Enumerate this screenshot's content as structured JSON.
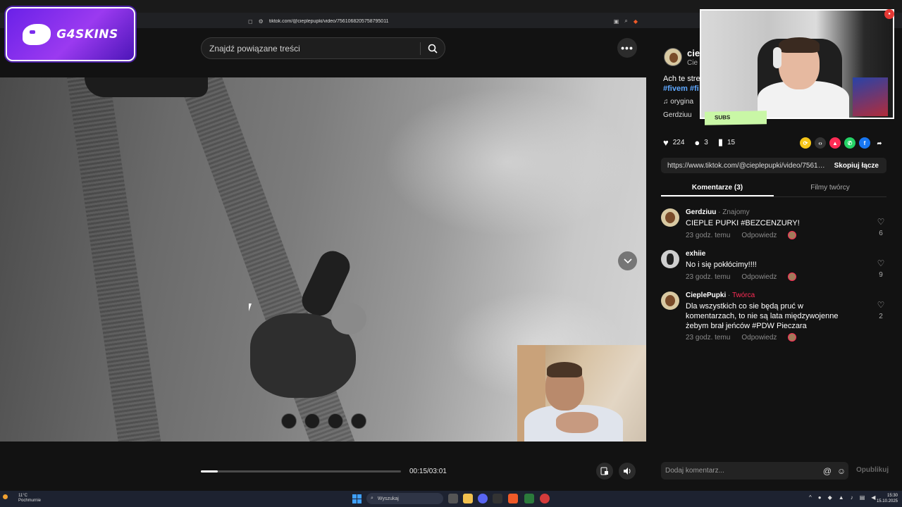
{
  "browser": {
    "tab_title": "",
    "url": "tiktok.com/@cieplepupki/video/7561068205758795011"
  },
  "overlay": {
    "logo_text": "G4SKINS",
    "subs_label": "SUBS"
  },
  "header": {
    "search_placeholder": "Znajdź powiązane treści",
    "more_label": "•••"
  },
  "player": {
    "time": "00:15/03:01",
    "progress": 0.083
  },
  "author": {
    "name": "cie",
    "sub": "Cie",
    "description": "Ach te stre",
    "tags": "#fivem #fi",
    "music": "♫  orygina",
    "tagged": "Gerdziuu"
  },
  "actions": {
    "likes": "224",
    "comments": "3",
    "saves": "15"
  },
  "share_link": {
    "url": "https://www.tiktok.com/@cieplepupki/video/75610...",
    "copy_label": "Skopiuj łącze"
  },
  "tabs": [
    {
      "label": "Komentarze (3)"
    },
    {
      "label": "Filmy twórcy"
    }
  ],
  "comments": [
    {
      "author": "Gerdziuu",
      "badge": "Znajomy",
      "text": "CIEPLE PUPKI #BEZCENZURY!",
      "time": "23 godz. temu",
      "reply": "Odpowiedz",
      "likes": "6"
    },
    {
      "author": "exhiie",
      "badge": "",
      "text": "No i się pokłócimy!!!!",
      "time": "23 godz. temu",
      "reply": "Odpowiedz",
      "likes": "9"
    },
    {
      "author": "CieplePupki",
      "badge": "Twórca",
      "text": "Dla wszystkich co sie będą pruć w komentarzach, to nie są lata międzywojenne żebym brał jeńców #PDW Pieczara",
      "time": "23 godz. temu",
      "reply": "Odpowiedz",
      "likes": "2"
    }
  ],
  "comment_box": {
    "placeholder": "Dodaj komentarz...",
    "publish_label": "Opublikuj"
  },
  "taskbar": {
    "weather_temp": "11°C",
    "weather_desc": "Pochmurnie",
    "search_label": "Wyszukaj",
    "time": "15:30",
    "date": "15.10.2025"
  },
  "colors": {
    "accent": "#fe2c55",
    "link": "#5fa8ff",
    "logo_purple": "#7a2cee",
    "subs_green": "#c9f7a6"
  }
}
